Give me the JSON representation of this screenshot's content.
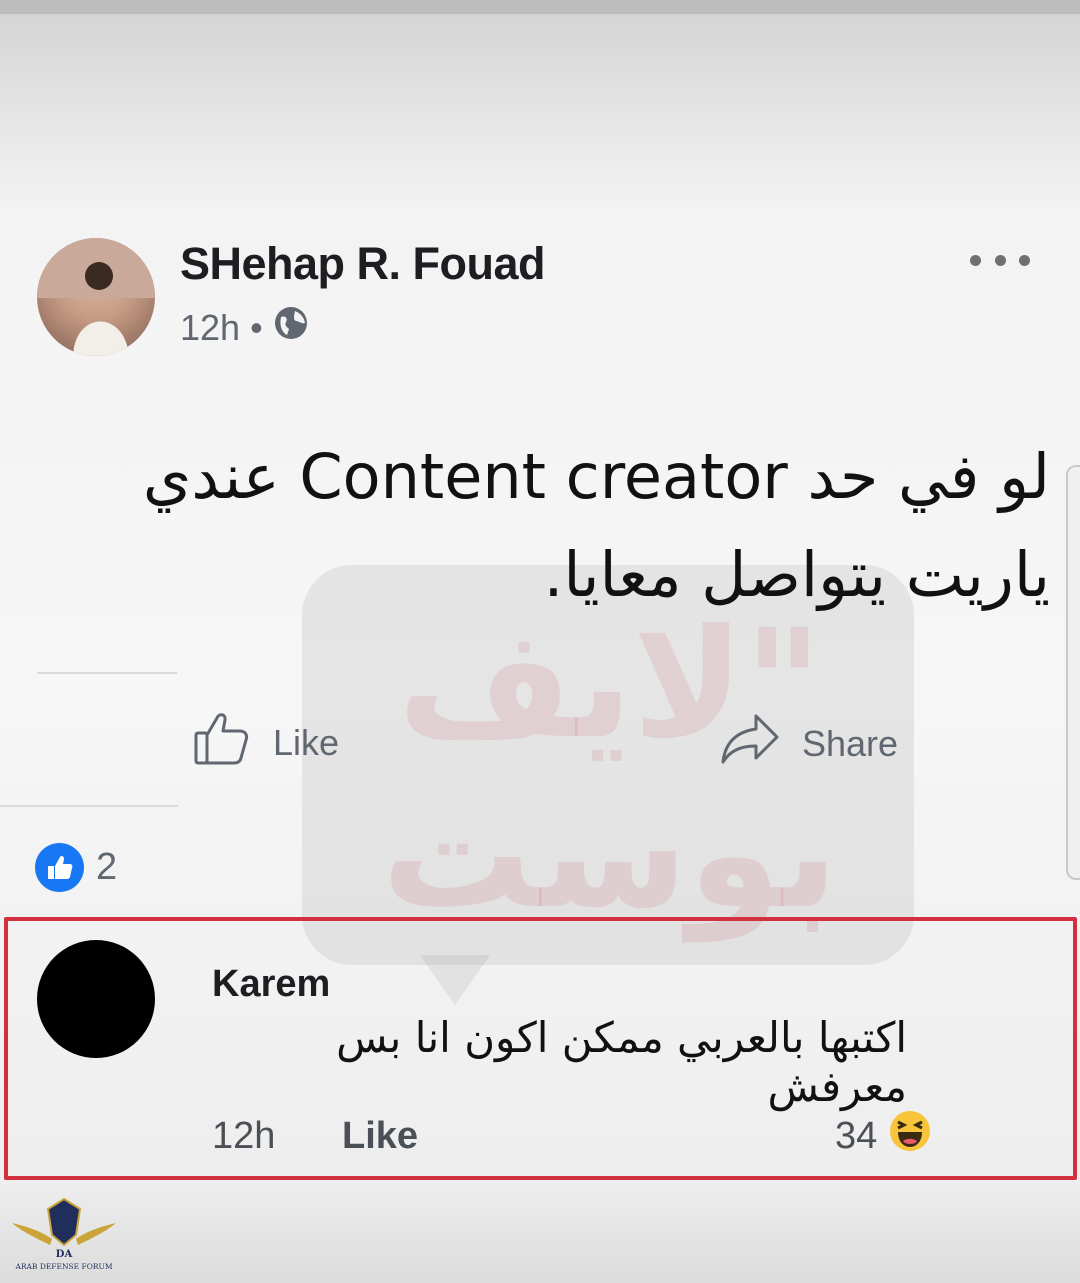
{
  "post": {
    "author_name": "SHehap R. Fouad",
    "time": "12h",
    "separator": "•",
    "text_line1": "لو في حد Content creator عندي",
    "text_line2": "ياريت يتواصل معايا."
  },
  "actions": {
    "like_label": "Like",
    "share_label": "Share"
  },
  "reactions": {
    "count": "2"
  },
  "watermark": {
    "line1": "\"لايف",
    "line2": "بوست"
  },
  "comment": {
    "author_name": "Karem",
    "text": "اكتبها بالعربي ممكن اكون انا بس معرفش",
    "time": "12h",
    "like_label": "Like",
    "reaction_count": "34"
  },
  "forum_logo": {
    "text": "ARAB DEFENSE FORUM",
    "abbr": "DA"
  },
  "colors": {
    "highlight_border": "#d2303f",
    "like_blue": "#1877f2",
    "haha_yellow": "#f7c43a"
  },
  "icons": [
    "globe-icon",
    "more-options-icon",
    "thumbs-up-outline-icon",
    "share-arrow-icon",
    "like-reaction-icon",
    "haha-reaction-icon"
  ]
}
